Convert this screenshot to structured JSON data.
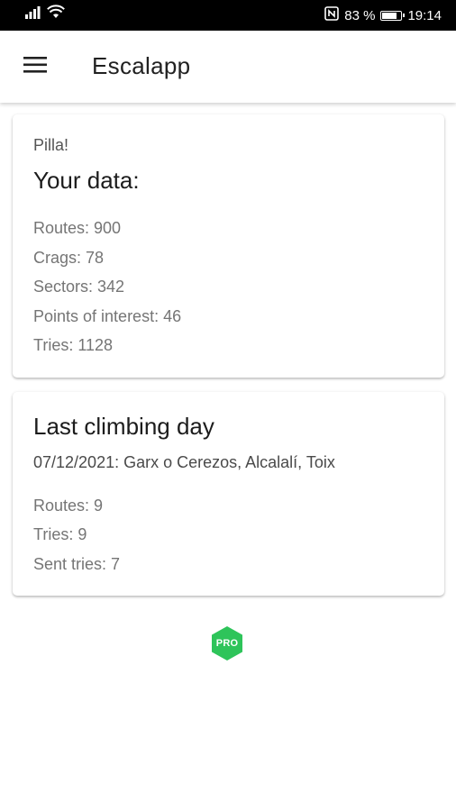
{
  "status_bar": {
    "battery_percent": "83 %",
    "battery_level": 0.83,
    "time": "19:14",
    "icons": [
      "signal-icon",
      "wifi-icon",
      "nfc-icon",
      "battery-icon"
    ]
  },
  "app_bar": {
    "title": "Escalapp",
    "menu_icon": "hamburger-menu-icon"
  },
  "data_card": {
    "greeting": "Pilla!",
    "title": "Your data:",
    "stats": [
      "Routes: 900",
      "Crags: 78",
      "Sectors: 342",
      "Points of interest: 46",
      "Tries: 1128"
    ]
  },
  "climbing_day_card": {
    "title": "Last climbing day",
    "subtitle": "07/12/2021: Garx o Cerezos, Alcalalí, Toix",
    "stats": [
      "Routes: 9",
      "Tries: 9",
      "Sent tries: 7"
    ]
  },
  "pro_badge": {
    "label": "PRO",
    "color": "#2ec45a"
  }
}
